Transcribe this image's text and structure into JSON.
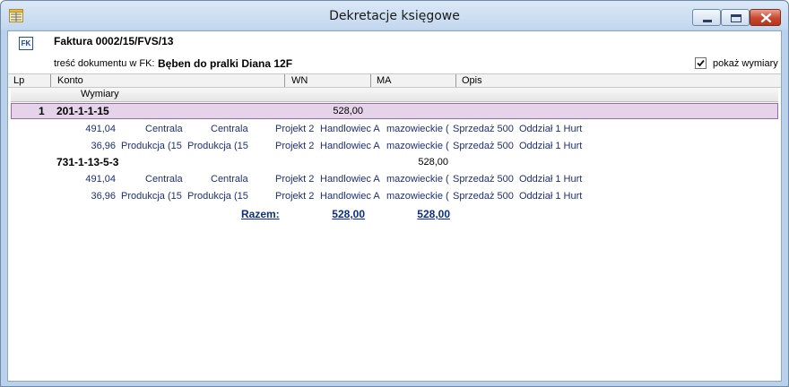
{
  "window": {
    "title": "Dekretacje księgowe",
    "app_icon": "ledger-icon",
    "controls": {
      "minimize": "minimize-icon",
      "maximize": "maximize-icon",
      "close": "close-icon"
    }
  },
  "document": {
    "icon_text": "FK",
    "title": "Faktura 0002/15/FVS/13",
    "content_label": "treść dokumentu w FK:",
    "content_value": "Bęben do pralki Diana 12F",
    "show_dimensions_label": "pokaż wymiary",
    "show_dimensions_checked": true
  },
  "grid": {
    "columns": [
      "Lp",
      "Konto",
      "WN",
      "MA",
      "Opis"
    ],
    "subheader": "Wymiary",
    "entries": [
      {
        "lp": "1",
        "account": "201-1-1-15",
        "wn": "528,00",
        "ma": "",
        "dimensions": [
          {
            "amount": "491,04",
            "d1": "Centrala",
            "d2": "Centrala",
            "d3": "Projekt 2",
            "d4": "Handlowiec A",
            "d5": "mazowieckie (",
            "d6": "Sprzedaż 500",
            "d7": "Oddział 1 Hurt"
          },
          {
            "amount": "36,96",
            "d1": "Produkcja (15",
            "d2": "Produkcja (15",
            "d3": "Projekt 2",
            "d4": "Handlowiec A",
            "d5": "mazowieckie (",
            "d6": "Sprzedaż 500",
            "d7": "Oddział 1 Hurt"
          }
        ]
      },
      {
        "lp": "",
        "account": "731-1-13-5-3",
        "wn": "",
        "ma": "528,00",
        "dimensions": [
          {
            "amount": "491,04",
            "d1": "Centrala",
            "d2": "Centrala",
            "d3": "Projekt 2",
            "d4": "Handlowiec A",
            "d5": "mazowieckie (",
            "d6": "Sprzedaż 500",
            "d7": "Oddział 1 Hurt"
          },
          {
            "amount": "36,96",
            "d1": "Produkcja (15",
            "d2": "Produkcja (15",
            "d3": "Projekt 2",
            "d4": "Handlowiec A",
            "d5": "mazowieckie (",
            "d6": "Sprzedaż 500",
            "d7": "Oddział 1 Hurt"
          }
        ]
      }
    ],
    "totals": {
      "label": "Razem:",
      "wn": "528,00",
      "ma": "528,00"
    }
  }
}
